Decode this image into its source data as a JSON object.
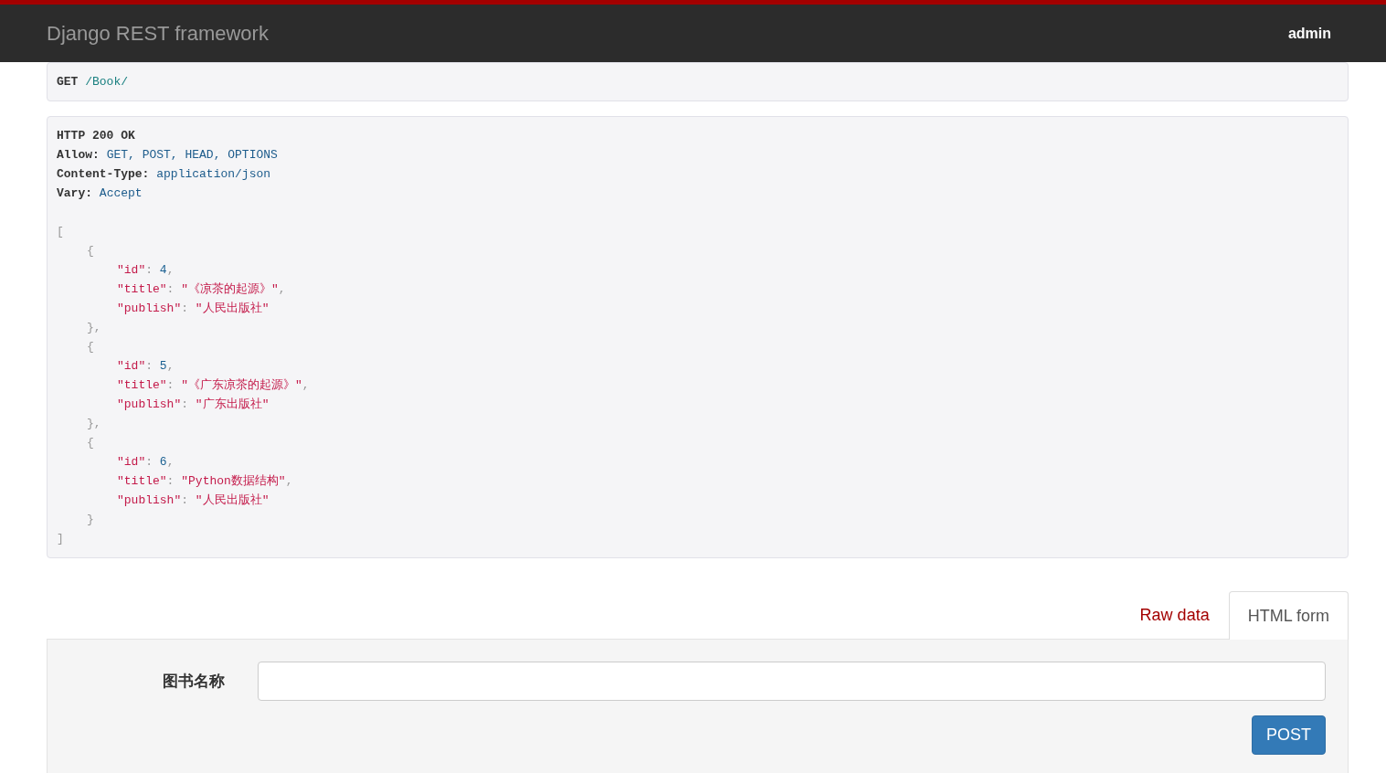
{
  "navbar": {
    "brand": "Django REST framework",
    "user": "admin"
  },
  "request": {
    "method": "GET",
    "path": "/Book/"
  },
  "response": {
    "status": "HTTP 200 OK",
    "headers": [
      {
        "name": "Allow:",
        "value": "GET, POST, HEAD, OPTIONS"
      },
      {
        "name": "Content-Type:",
        "value": "application/json"
      },
      {
        "name": "Vary:",
        "value": "Accept"
      }
    ],
    "body": {
      "open": "[",
      "close": "]",
      "items": [
        {
          "open": "{",
          "close": "},",
          "fields": [
            {
              "key": "\"id\"",
              "colon": ":",
              "value": "4",
              "kind": "number",
              "comma": ","
            },
            {
              "key": "\"title\"",
              "colon": ":",
              "value": "\"《凉茶的起源》\"",
              "kind": "string",
              "comma": ","
            },
            {
              "key": "\"publish\"",
              "colon": ":",
              "value": "\"人民出版社\"",
              "kind": "string"
            }
          ]
        },
        {
          "open": "{",
          "close": "},",
          "fields": [
            {
              "key": "\"id\"",
              "colon": ":",
              "value": "5",
              "kind": "number",
              "comma": ","
            },
            {
              "key": "\"title\"",
              "colon": ":",
              "value": "\"《广东凉茶的起源》\"",
              "kind": "string",
              "comma": ","
            },
            {
              "key": "\"publish\"",
              "colon": ":",
              "value": "\"广东出版社\"",
              "kind": "string"
            }
          ]
        },
        {
          "open": "{",
          "close": "}",
          "fields": [
            {
              "key": "\"id\"",
              "colon": ":",
              "value": "6",
              "kind": "number",
              "comma": ","
            },
            {
              "key": "\"title\"",
              "colon": ":",
              "value": "\"Python数据结构\"",
              "kind": "string",
              "comma": ","
            },
            {
              "key": "\"publish\"",
              "colon": ":",
              "value": "\"人民出版社\"",
              "kind": "string"
            }
          ]
        }
      ]
    }
  },
  "tabs": [
    {
      "label": "Raw data",
      "selected": false
    },
    {
      "label": "HTML form",
      "selected": true
    }
  ],
  "form": {
    "fields": [
      {
        "label": "图书名称"
      }
    ],
    "button": "POST"
  }
}
